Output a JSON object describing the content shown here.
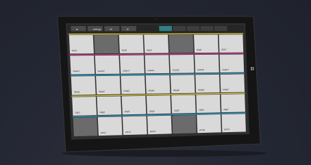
{
  "image_description_free": true,
  "colors": {
    "background": "#232733",
    "device_bezel": "#141414",
    "screen_bg": "#2f2f2f",
    "pad_light": "#d9d9d9",
    "pad_dark": "#6b6b6b",
    "accent_yellow": "#e8d23a",
    "accent_magenta": "#d6338f",
    "accent_cyan": "#2ba3d6",
    "toolbar_active": "#2f7f86"
  },
  "toolbar": {
    "left_buttons": [
      {
        "label": "■",
        "icon": "stop-icon"
      },
      {
        "label": "settings",
        "icon": "settings-icon"
      },
      {
        "label": "lib",
        "icon": "library-icon"
      },
      {
        "label": "⚙",
        "icon": "gear-icon"
      }
    ],
    "right_tabs": [
      {
        "label": "",
        "active": true
      },
      {
        "label": "",
        "active": false
      },
      {
        "label": "",
        "active": false
      },
      {
        "label": "",
        "active": false
      },
      {
        "label": "",
        "active": false
      }
    ]
  },
  "grid": {
    "rows": [
      {
        "accent": "accent_yellow",
        "pads": [
          {
            "label": "kick1",
            "shade": "light"
          },
          {
            "label": "",
            "shade": "dark"
          },
          {
            "label": "kick3",
            "shade": "light"
          },
          {
            "label": "kick4",
            "shade": "light"
          },
          {
            "label": "",
            "shade": "dark"
          },
          {
            "label": "kick6",
            "shade": "light"
          },
          {
            "label": "kick7",
            "shade": "light"
          }
        ]
      },
      {
        "accent": "accent_magenta",
        "pads": [
          {
            "label": "snare1",
            "shade": "light"
          },
          {
            "label": "snare2",
            "shade": "light"
          },
          {
            "label": "snare3",
            "shade": "light"
          },
          {
            "label": "snare4",
            "shade": "light"
          },
          {
            "label": "snare5",
            "shade": "light"
          },
          {
            "label": "snare6",
            "shade": "light"
          },
          {
            "label": "snare7",
            "shade": "light"
          }
        ]
      },
      {
        "accent": "accent_cyan",
        "pads": [
          {
            "label": "hihat1",
            "shade": "light"
          },
          {
            "label": "hihat2",
            "shade": "light"
          },
          {
            "label": "hihat3",
            "shade": "light"
          },
          {
            "label": "hihat4",
            "shade": "light"
          },
          {
            "label": "hihat5",
            "shade": "light"
          },
          {
            "label": "hihat6",
            "shade": "light"
          },
          {
            "label": "hihat7",
            "shade": "light"
          }
        ]
      },
      {
        "accent": "accent_yellow",
        "pads": [
          {
            "label": "clap1",
            "shade": "light"
          },
          {
            "label": "clap2",
            "shade": "light"
          },
          {
            "label": "clap3",
            "shade": "light"
          },
          {
            "label": "clap4",
            "shade": "light"
          },
          {
            "label": "clap5",
            "shade": "light"
          },
          {
            "label": "clap6",
            "shade": "light"
          },
          {
            "label": "clap7",
            "shade": "light"
          }
        ]
      },
      {
        "accent": "accent_cyan",
        "pads": [
          {
            "label": "",
            "shade": "dark"
          },
          {
            "label": "perc2",
            "shade": "light"
          },
          {
            "label": "perc3",
            "shade": "light"
          },
          {
            "label": "perc4",
            "shade": "light"
          },
          {
            "label": "",
            "shade": "dark"
          },
          {
            "label": "perc6",
            "shade": "light"
          },
          {
            "label": "perc7",
            "shade": "light"
          }
        ]
      }
    ]
  }
}
